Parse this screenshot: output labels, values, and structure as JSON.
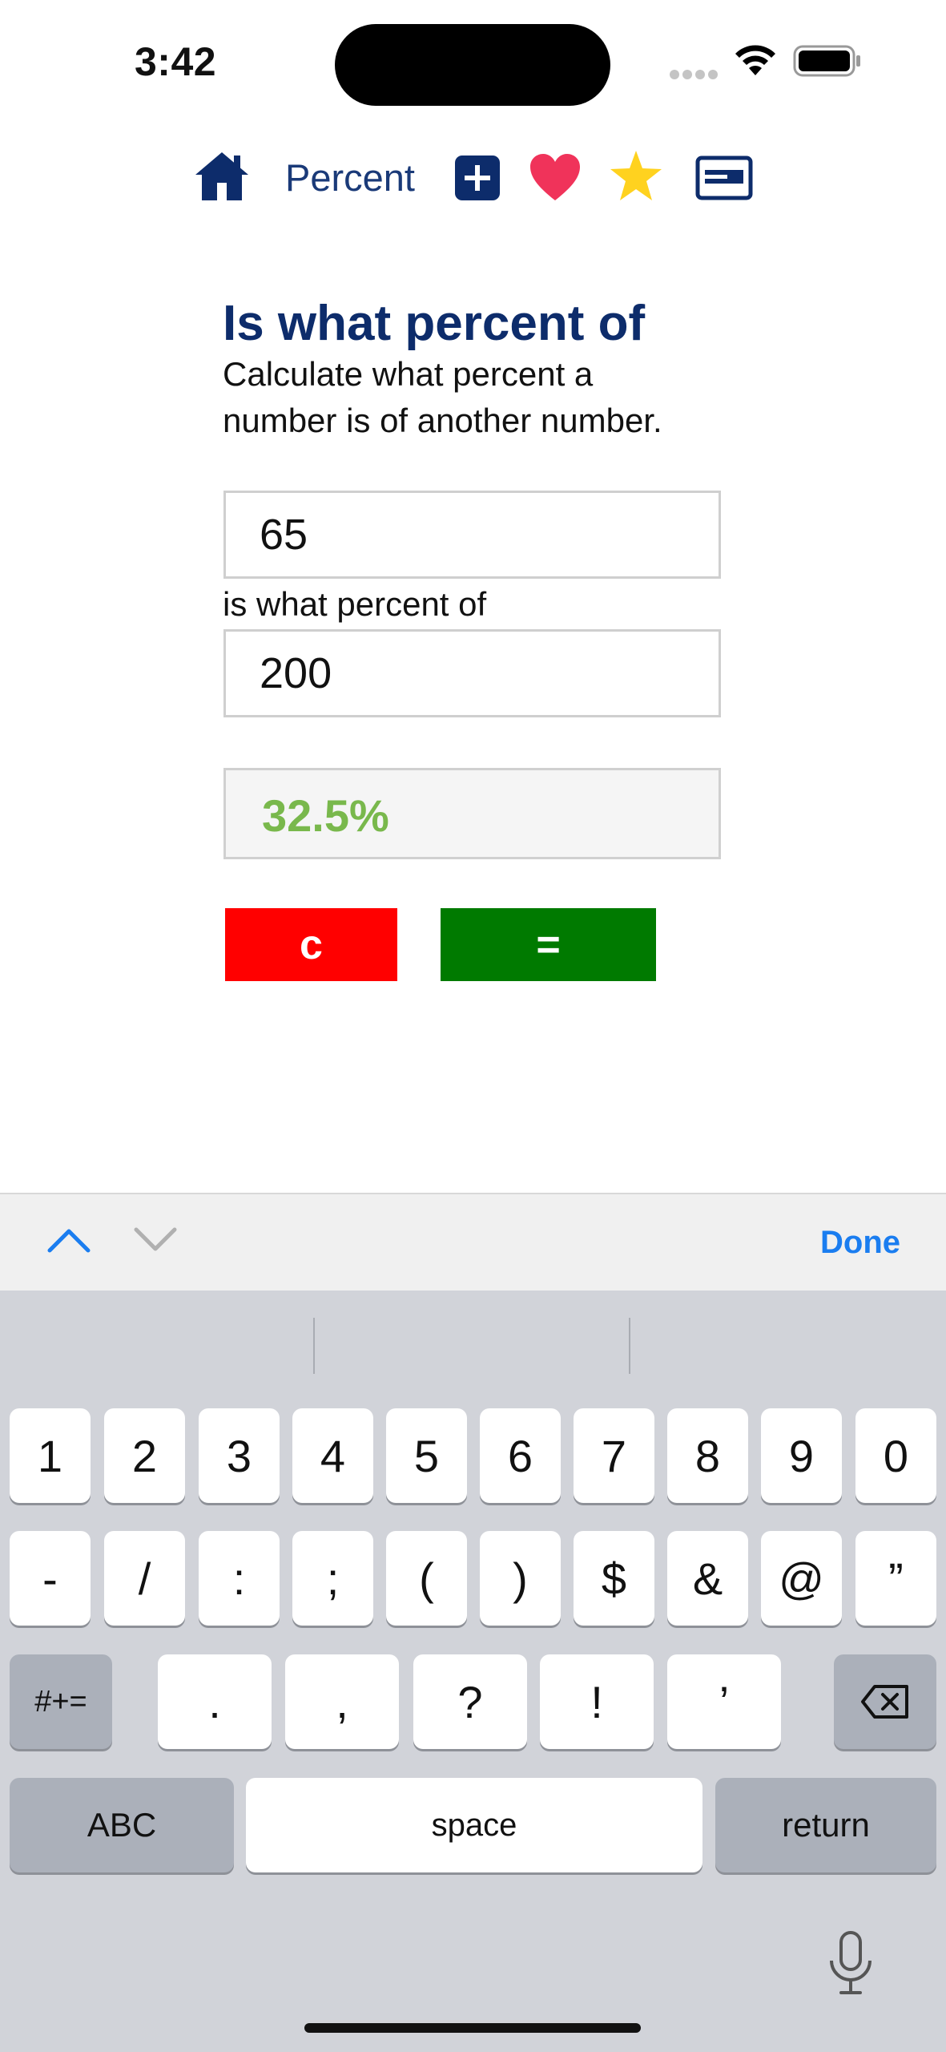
{
  "status_bar": {
    "time": "3:42"
  },
  "nav": {
    "title": "Percent",
    "icons": [
      "home-icon",
      "plus-icon",
      "heart-icon",
      "star-icon",
      "card-icon"
    ]
  },
  "calculator": {
    "heading": "Is what percent of",
    "description": "Calculate what percent a number is of another number.",
    "input_a": "65",
    "middle_label": "is what percent of",
    "input_b": "200",
    "result": "32.5%",
    "clear_label": "c",
    "equals_label": "="
  },
  "accessory_bar": {
    "done_label": "Done"
  },
  "keyboard": {
    "row1": [
      "1",
      "2",
      "3",
      "4",
      "5",
      "6",
      "7",
      "8",
      "9",
      "0"
    ],
    "row2": [
      "-",
      "/",
      ":",
      ";",
      "(",
      ")",
      "$",
      "&",
      "@",
      "”"
    ],
    "row3": [
      "#+=",
      ".",
      ",",
      "?",
      "!",
      "’"
    ],
    "abc_label": "ABC",
    "space_label": "space",
    "return_label": "return"
  },
  "colors": {
    "brand_navy": "#0d2c6b",
    "result_green": "#79b84c",
    "clear_red": "#ff0000",
    "equals_green": "#007a00",
    "accent_blue": "#1a7df0"
  }
}
